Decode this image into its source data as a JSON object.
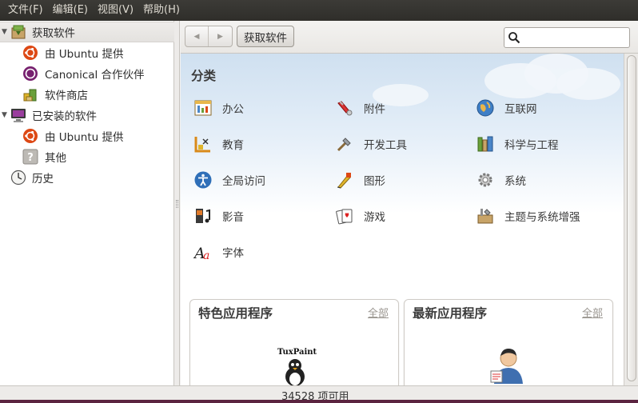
{
  "menubar": {
    "items": [
      "文件(F)",
      "编辑(E)",
      "视图(V)",
      "帮助(H)"
    ]
  },
  "sidebar": {
    "items": [
      {
        "label": "获取软件",
        "icon": "get-software-icon",
        "selected": true
      },
      {
        "label": "由 Ubuntu 提供",
        "icon": "ubuntu-icon"
      },
      {
        "label": "Canonical 合作伙伴",
        "icon": "canonical-icon"
      },
      {
        "label": "软件商店",
        "icon": "software-store-icon"
      },
      {
        "label": "已安装的软件",
        "icon": "monitor-icon"
      },
      {
        "label": "由 Ubuntu 提供",
        "icon": "ubuntu-icon"
      },
      {
        "label": "其他",
        "icon": "question-icon"
      },
      {
        "label": "历史",
        "icon": "clock-icon"
      }
    ]
  },
  "toolbar": {
    "breadcrumb": "获取软件",
    "search_value": ""
  },
  "content": {
    "categories_title": "分类",
    "categories": [
      {
        "label": "办公",
        "icon": "office-icon"
      },
      {
        "label": "附件",
        "icon": "accessories-icon"
      },
      {
        "label": "互联网",
        "icon": "internet-icon"
      },
      {
        "label": "教育",
        "icon": "education-icon"
      },
      {
        "label": "开发工具",
        "icon": "developer-tools-icon"
      },
      {
        "label": "科学与工程",
        "icon": "science-icon"
      },
      {
        "label": "全局访问",
        "icon": "accessibility-icon"
      },
      {
        "label": "图形",
        "icon": "graphics-icon"
      },
      {
        "label": "系统",
        "icon": "system-gear-icon"
      },
      {
        "label": "影音",
        "icon": "multimedia-icon"
      },
      {
        "label": "游戏",
        "icon": "games-icon"
      },
      {
        "label": "主题与系统增强",
        "icon": "themes-tweaks-icon"
      },
      {
        "label": "字体",
        "icon": "fonts-icon"
      }
    ],
    "featured": {
      "title": "特色应用程序",
      "link": "全部",
      "app_icon": "tuxpaint-icon",
      "app_logo_text": "TuxPaint"
    },
    "whats_new": {
      "title": "最新应用程序",
      "link": "全部",
      "app_icon": "user-avatar-icon"
    }
  },
  "status": {
    "text": "34528 项可用"
  },
  "colors": {
    "menubar": "#3c3b37",
    "ubuntu_orange": "#dd4814",
    "canonical_aubergine": "#77216f",
    "sky": "#cfe0f0"
  }
}
